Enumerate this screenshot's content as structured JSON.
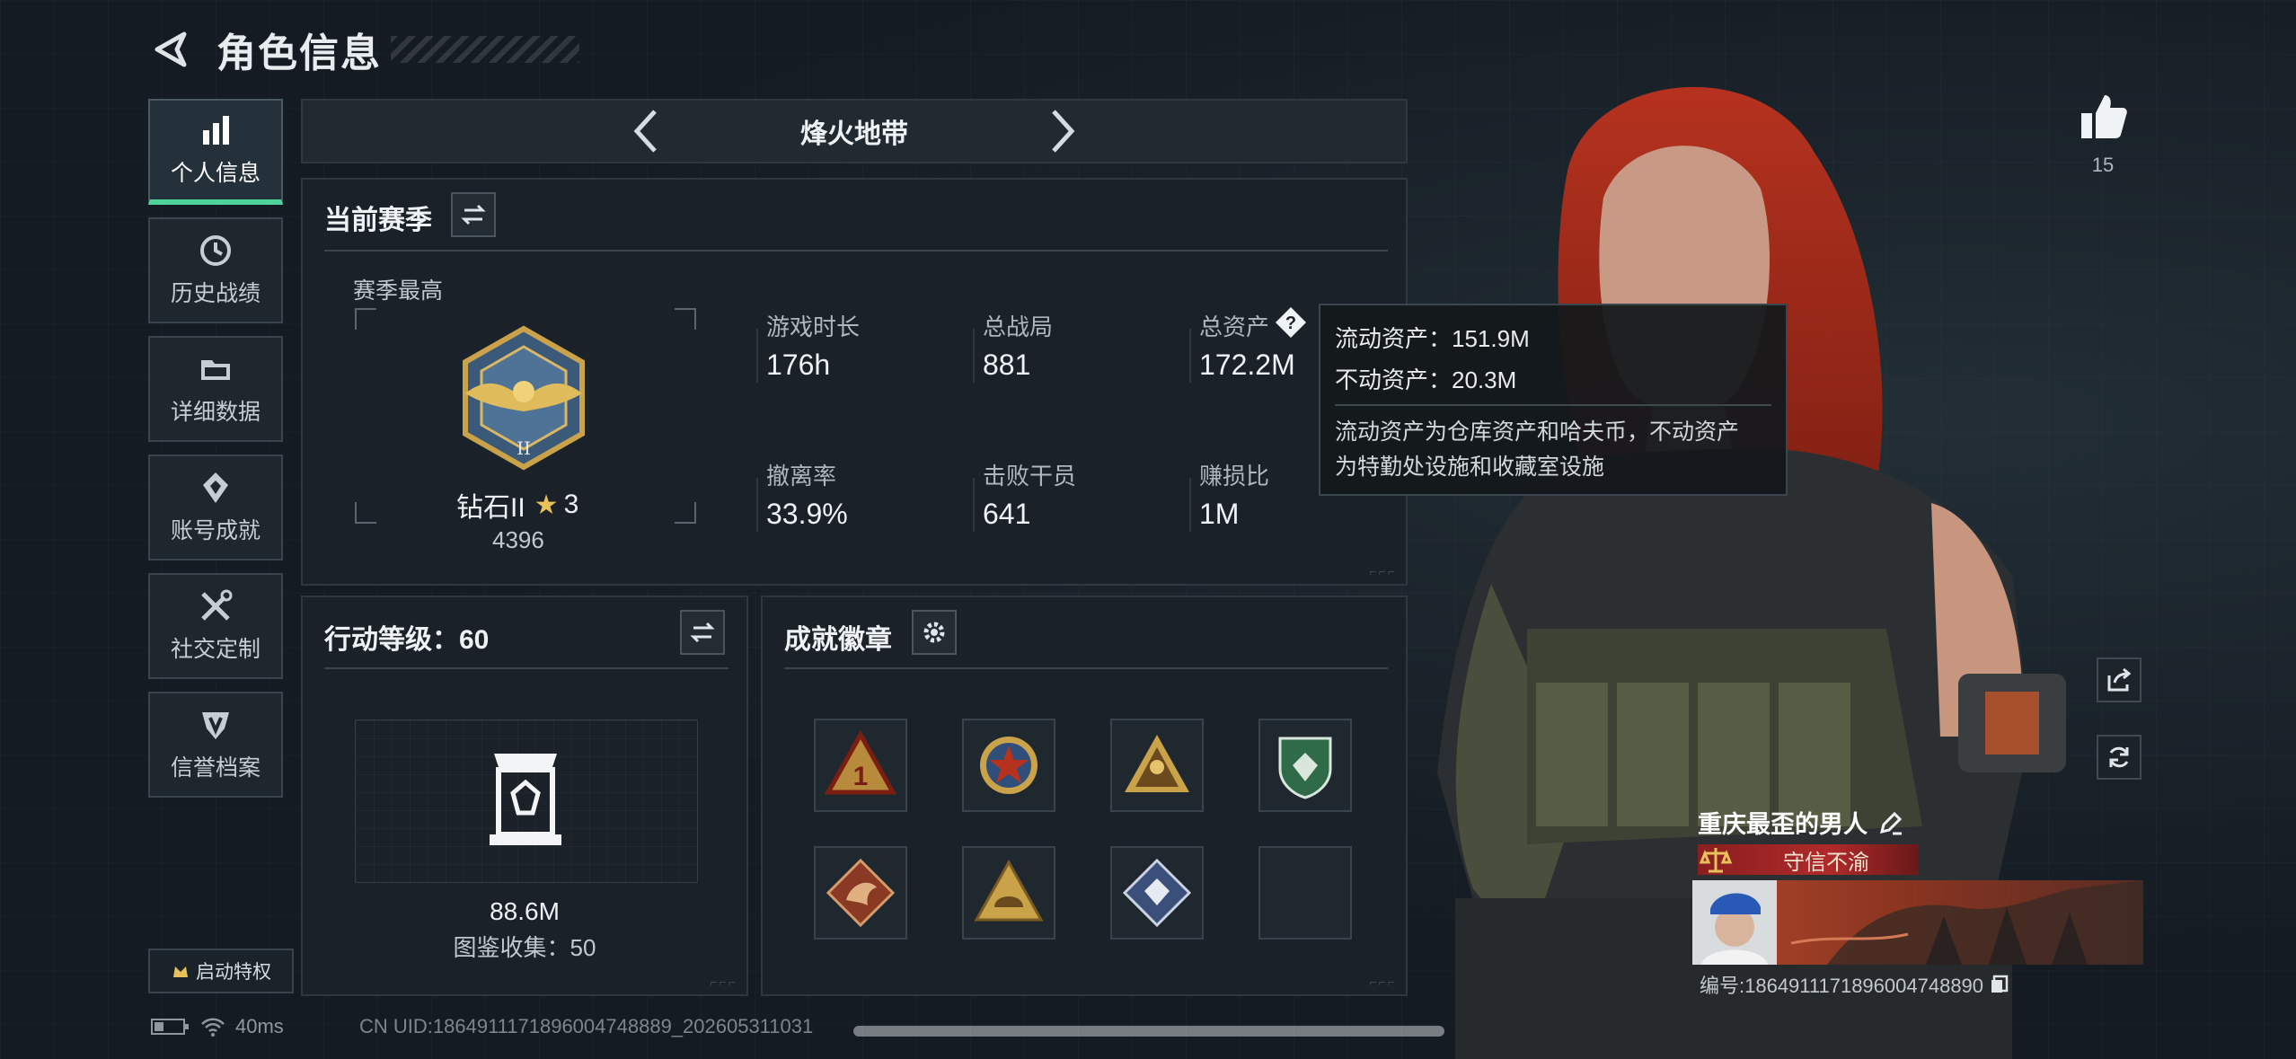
{
  "header": {
    "title": "角色信息"
  },
  "sidebar": {
    "items": [
      {
        "label": "个人信息",
        "icon": "bar-chart-icon",
        "active": true
      },
      {
        "label": "历史战绩",
        "icon": "clock-icon"
      },
      {
        "label": "详细数据",
        "icon": "folder-icon"
      },
      {
        "label": "账号成就",
        "icon": "achievement-icon"
      },
      {
        "label": "社交定制",
        "icon": "tools-icon"
      },
      {
        "label": "信誉档案",
        "icon": "shield-badge-icon"
      }
    ],
    "privilege": "启动特权"
  },
  "mode": {
    "name": "烽火地带"
  },
  "season": {
    "title": "当前赛季",
    "best_label": "赛季最高",
    "rank_name": "钻石II",
    "rank_stars": "3",
    "rank_score": "4396",
    "stats": [
      {
        "label": "游戏时长",
        "value": "176h"
      },
      {
        "label": "总战局",
        "value": "881"
      },
      {
        "label": "总资产",
        "value": "172.2M"
      },
      {
        "label": "撤离率",
        "value": "33.9%"
      },
      {
        "label": "击败干员",
        "value": "641"
      },
      {
        "label": "赚损比",
        "value": "1M"
      }
    ]
  },
  "tooltip": {
    "liquid": "流动资产：151.9M",
    "fixed": "不动资产：20.3M",
    "desc1": "流动资产为仓库资产和哈夫币，不动资产",
    "desc2": "为特勤处设施和收藏室设施"
  },
  "action": {
    "title": "行动等级：60",
    "value": "88.6M",
    "collection": "图鉴收集：50"
  },
  "badges": {
    "title": "成就徽章"
  },
  "profile": {
    "likes": "15",
    "name": "重庆最歪的男人",
    "credit": "守信不渝",
    "id": "编号:1864911171896004748890"
  },
  "status": {
    "ping": "40ms",
    "uid": "CN UID:1864911171896004748889_202605311031"
  },
  "colors": {
    "accent": "#4fd39a",
    "credit": "#b02a2a",
    "background": "#141b22"
  }
}
